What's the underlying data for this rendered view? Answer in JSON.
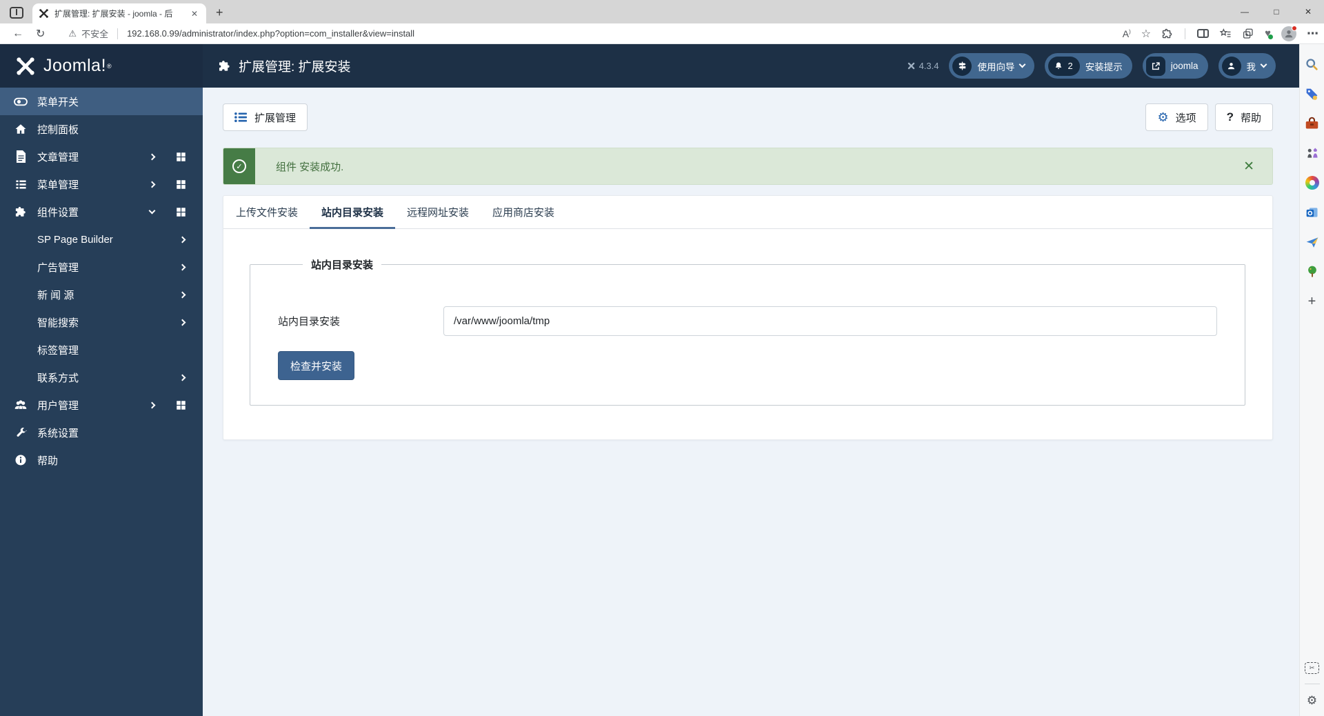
{
  "browser": {
    "tab": {
      "title": "扩展管理: 扩展安装 - joomla - 后",
      "close_icon": "✕",
      "new_tab_icon": "+"
    },
    "window_controls": {
      "minimize": "—",
      "maximize": "□",
      "close": "✕"
    },
    "toolbar": {
      "back_icon": "←",
      "refresh_icon": "↻",
      "warning_icon": "⚠",
      "security_label": "不安全",
      "url": "192.168.0.99/administrator/index.php?option=com_installer&view=install",
      "read_aloud_label": "A",
      "favorite_icon": "☆",
      "more_icon": "⋯",
      "heart_icon": "♥"
    },
    "edge_rail": {
      "add_icon": "+",
      "capture_icon": "✂",
      "settings_icon": "⚙"
    }
  },
  "header": {
    "logo_text": "Joomla!",
    "logo_reg": "®",
    "page_title": "扩展管理: 扩展安装",
    "version": "4.3.4",
    "guide_button": "使用向导",
    "notification_count": "2",
    "notification_label": "安装提示",
    "site_button": "joomla",
    "user_button": "我"
  },
  "sidebar": {
    "items": [
      {
        "label": "菜单开关"
      },
      {
        "label": "控制面板"
      },
      {
        "label": "文章管理"
      },
      {
        "label": "菜单管理"
      },
      {
        "label": "组件设置"
      },
      {
        "label": "SP Page Builder"
      },
      {
        "label": "广告管理"
      },
      {
        "label": "新 闻 源"
      },
      {
        "label": "智能搜索"
      },
      {
        "label": "标签管理"
      },
      {
        "label": "联系方式"
      },
      {
        "label": "用户管理"
      },
      {
        "label": "系统设置"
      },
      {
        "label": "帮助"
      }
    ]
  },
  "toolbar": {
    "extensions_button": "扩展管理",
    "options_button": "选项",
    "help_button": "帮助"
  },
  "alert": {
    "message": "组件 安装成功.",
    "close_icon": "✕",
    "check_icon": "✓"
  },
  "tabs": {
    "items": [
      "上传文件安装",
      "站内目录安装",
      "远程网址安装",
      "应用商店安装"
    ],
    "active": "站内目录安装"
  },
  "form": {
    "legend": "站内目录安装",
    "field_label": "站内目录安装",
    "field_value": "/var/www/joomla/tmp",
    "submit_button": "检查并安装"
  },
  "colors": {
    "header_bg": "#1d3046",
    "logo_bg": "#1b2c42",
    "sidebar_bg": "#263e58",
    "sidebar_active_bg": "#3f5e81",
    "pill_bg": "#41678f",
    "pill_icon_bg": "#152a40",
    "content_bg": "#eef3f9",
    "success_dark": "#467c46",
    "success_light": "#dbe8d8",
    "accent_blue": "#2563ad",
    "primary_button": "#3d6390",
    "tab_underline": "#4a6d99"
  }
}
